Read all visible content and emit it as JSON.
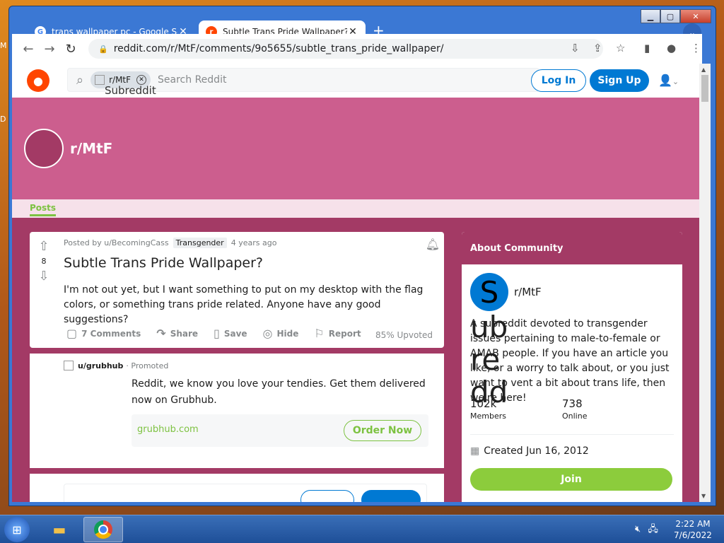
{
  "tabs": [
    {
      "title": "trans wallpaper pc - Google Sear",
      "close": "✕",
      "favicon": "G"
    },
    {
      "title": "Subtle Trans Pride Wallpaper? : M",
      "close": "✕",
      "favicon": "r"
    }
  ],
  "toolbar": {
    "url": "reddit.com/r/MtF/comments/9o5655/subtle_trans_pride_wallpaper/"
  },
  "reddit": {
    "chip_label": "r/MtF",
    "chip_alt": "Subreddit Icon",
    "search_placeholder": "Search Reddit",
    "login": "Log In",
    "signup": "Sign Up",
    "subreddit_name": "r/MtF",
    "nav_posts": "Posts"
  },
  "post": {
    "votes": "8",
    "posted_by": "Posted by u/BecomingCass",
    "flair": "Transgender",
    "age": "4 years ago",
    "title": "Subtle Trans Pride Wallpaper?",
    "body": "I'm not out yet, but I want something to put on my desktop with the flag colors, or something trans pride related. Anyone have any good suggestions?",
    "comments": "7 Comments",
    "share": "Share",
    "save": "Save",
    "hide": "Hide",
    "report": "Report",
    "upvoted": "85% Upvoted"
  },
  "promo": {
    "user": "u/grubhub",
    "label": "· Promoted",
    "text": "Reddit, we know you love your tendies. Get them delivered now on Grubhub.",
    "domain": "grubhub.com",
    "cta": "Order Now"
  },
  "sidebar": {
    "header": "About Community",
    "avatar_letter": "S",
    "alt_overflow": "ubredd",
    "name": "r/MtF",
    "description": "A subreddit devoted to transgender issues pertaining to male-to-female or AMAB people. If you have an article you like, or a worry to talk about, or you just want to vent a bit about trans life, then we're here!",
    "members_value": "102k",
    "members_label": "Members",
    "online_value": "738",
    "online_label": "Online",
    "created": "Created Jun 16, 2012",
    "join": "Join"
  },
  "taskbar": {
    "time": "2:22 AM",
    "date": "7/6/2022"
  },
  "colors": {
    "banner": "#cc5e8e",
    "page_bg": "#a33a65",
    "reddit_blue": "#0079d3",
    "accent_green": "#7dc241",
    "chrome_frame": "#3b78d4"
  },
  "icons": [
    "search-icon",
    "close-icon",
    "plus-icon",
    "back-icon",
    "forward-icon",
    "reload-icon",
    "lock-icon",
    "install-icon",
    "share-icon",
    "star-icon",
    "sidepanel-icon",
    "profile-icon",
    "menu-icon",
    "upvote-icon",
    "downvote-icon",
    "bell-icon",
    "comment-icon",
    "share-arrow-icon",
    "bookmark-icon",
    "hide-icon",
    "flag-icon",
    "calendar-icon",
    "user-icon",
    "chevron-down-icon"
  ]
}
